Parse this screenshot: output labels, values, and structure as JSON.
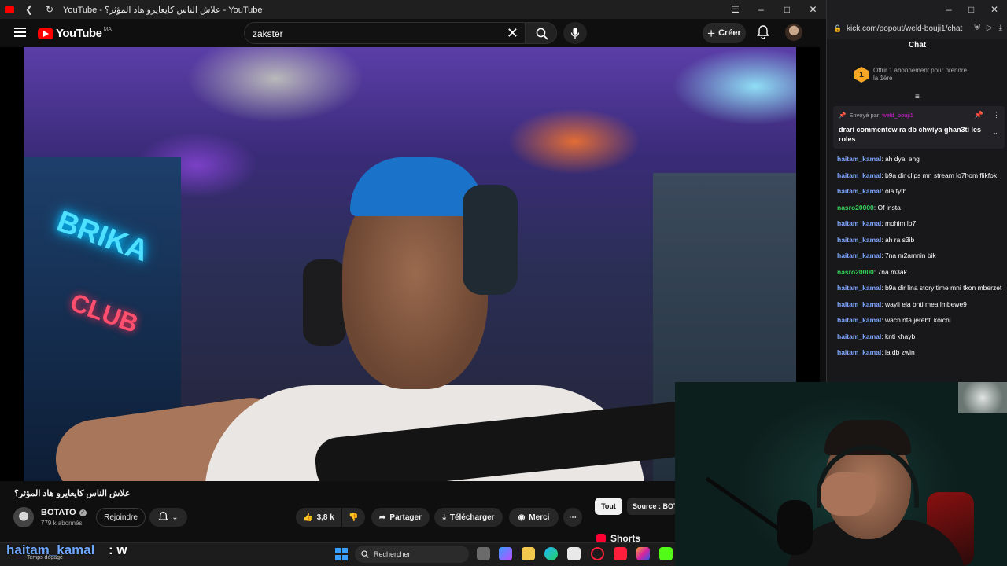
{
  "youtube_window": {
    "title": "YouTube - علاش الناس كايعايرو هاد المؤثر؟ - YouTube",
    "header": {
      "logo_text": "YouTube",
      "region": "MA",
      "search_value": "zakster",
      "create_label": "Créer"
    },
    "video": {
      "title": "علاش الناس كايعايرو هاد المؤثر؟",
      "neon_line1": "BRIKA",
      "neon_line2": "CLUB",
      "channel_name": "BOTATO",
      "subscribers": "779 k abonnés",
      "join_label": "Rejoindre",
      "like_count": "3,8 k",
      "share_label": "Partager",
      "download_label": "Télécharger",
      "thanks_label": "Merci"
    },
    "sidebar": {
      "chip_all": "Tout",
      "chip_source": "Source : BOTATO",
      "shorts_label": "Shorts"
    }
  },
  "kick_window": {
    "url": "kick.com/popout/weld-bouji1/chat",
    "chat_title": "Chat",
    "sub_offer_number": "1",
    "sub_offer_text": "Offrir 1 abonnement pour prendre la 1ère",
    "pinned": {
      "sent_by_label": "Envoyé par",
      "sender": "weld_bouji1",
      "message": "drari commentew ra db chwiya ghan3ti les roles"
    },
    "messages": [
      {
        "user": "haitam_kamal",
        "text": ": ah dyal eng",
        "color": "#7ea6ff"
      },
      {
        "user": "haitam_kamal",
        "text": ": b9a dir clips mn stream lo7hom flikfok",
        "color": "#7ea6ff"
      },
      {
        "user": "haitam_kamal",
        "text": ": ola fytb",
        "color": "#7ea6ff"
      },
      {
        "user": "nasro20000",
        "text": ": Of insta",
        "color": "#34d058"
      },
      {
        "user": "haitam_kamal",
        "text": ": mohim lo7",
        "color": "#7ea6ff"
      },
      {
        "user": "haitam_kamal",
        "text": ": ah ra s3ib",
        "color": "#7ea6ff"
      },
      {
        "user": "haitam_kamal",
        "text": ": 7na m2amnin bik",
        "color": "#7ea6ff"
      },
      {
        "user": "nasro20000",
        "text": ": 7na m3ak",
        "color": "#34d058"
      },
      {
        "user": "haitam_kamal",
        "text": ": b9a dir lina story time mni tkon mberzet",
        "color": "#7ea6ff"
      },
      {
        "user": "haitam_kamal",
        "text": ": wayli ela bnti mea lmbewe9",
        "color": "#7ea6ff"
      },
      {
        "user": "haitam_kamal",
        "text": ": wach nta jerebti koichi",
        "color": "#7ea6ff"
      },
      {
        "user": "haitam_kamal",
        "text": ": knti khayb",
        "color": "#7ea6ff"
      },
      {
        "user": "haitam_kamal",
        "text": ": la db zwin",
        "color": "#7ea6ff"
      }
    ]
  },
  "overlay": {
    "username": "haitam_kamal",
    "message": ": w",
    "sub_text": "Temps dégagé"
  },
  "taskbar": {
    "search_label": "Rechercher"
  }
}
